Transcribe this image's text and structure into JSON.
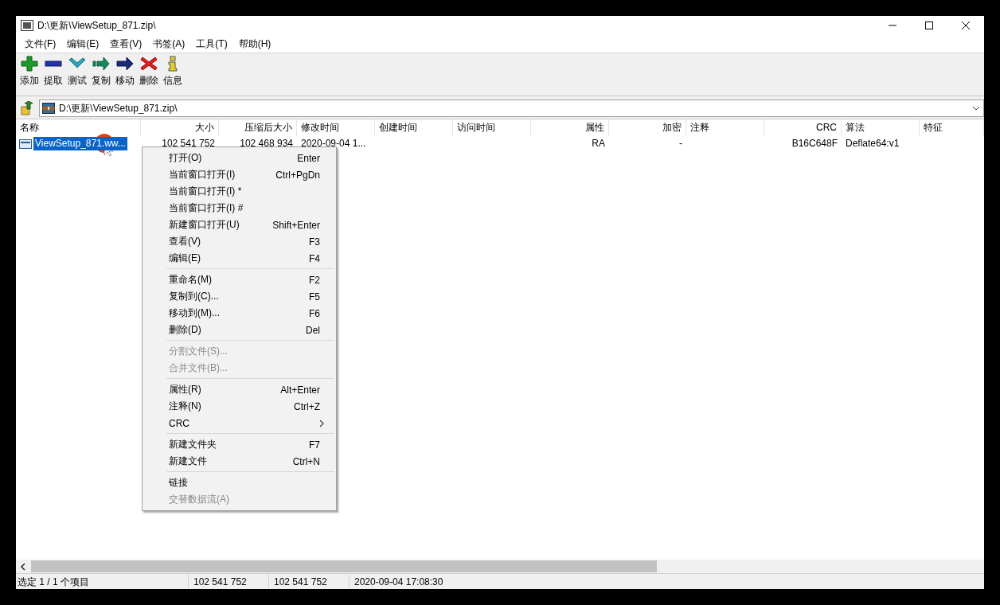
{
  "window": {
    "title": "D:\\更新\\ViewSetup_871.zip\\"
  },
  "menu_bar": [
    {
      "label": "文件(F)"
    },
    {
      "label": "编辑(E)"
    },
    {
      "label": "查看(V)"
    },
    {
      "label": "书签(A)"
    },
    {
      "label": "工具(T)"
    },
    {
      "label": "帮助(H)"
    }
  ],
  "toolbar": [
    {
      "kind": "add",
      "label": "添加"
    },
    {
      "kind": "extract",
      "label": "提取"
    },
    {
      "kind": "test",
      "label": "测试"
    },
    {
      "kind": "copy",
      "label": "复制"
    },
    {
      "kind": "move",
      "label": "移动"
    },
    {
      "kind": "delete",
      "label": "删除"
    },
    {
      "kind": "info",
      "label": "信息"
    }
  ],
  "address_bar": {
    "path": "D:\\更新\\ViewSetup_871.zip\\"
  },
  "file_list": {
    "columns": [
      {
        "label": "名称",
        "kind": "text"
      },
      {
        "label": "大小",
        "kind": "number"
      },
      {
        "label": "压缩后大小",
        "kind": "number"
      },
      {
        "label": "修改时间",
        "kind": "text"
      },
      {
        "label": "创建时间",
        "kind": "text"
      },
      {
        "label": "访问时间",
        "kind": "text"
      },
      {
        "label": "属性",
        "kind": "number"
      },
      {
        "label": "加密",
        "kind": "number"
      },
      {
        "label": "注释",
        "kind": "text"
      },
      {
        "label": "CRC",
        "kind": "number"
      },
      {
        "label": "算法",
        "kind": "text"
      },
      {
        "label": "特征",
        "kind": "text"
      }
    ],
    "rows": [
      {
        "selected": true,
        "cells": [
          "ViewSetup_871.ww...",
          "102 541 752",
          "102 468 934",
          "2020-09-04 1...",
          null,
          null,
          "RA",
          "-",
          null,
          "B16C648F",
          "Deflate64:v1",
          null
        ]
      }
    ]
  },
  "context_menu": {
    "items": [
      {
        "kind": "item",
        "label": "打开(O)",
        "shortcut": "Enter",
        "disabled": false
      },
      {
        "kind": "item",
        "label": "当前窗口打开(I)",
        "shortcut": "Ctrl+PgDn",
        "disabled": false
      },
      {
        "kind": "item",
        "label": "当前窗口打开(I) *",
        "disabled": false
      },
      {
        "kind": "item",
        "label": "当前窗口打开(I) #",
        "disabled": false
      },
      {
        "kind": "item",
        "label": "新建窗口打开(U)",
        "shortcut": "Shift+Enter",
        "disabled": false
      },
      {
        "kind": "item",
        "label": "查看(V)",
        "shortcut": "F3",
        "disabled": false
      },
      {
        "kind": "item",
        "label": "编辑(E)",
        "shortcut": "F4",
        "disabled": false
      },
      {
        "kind": "separator"
      },
      {
        "kind": "item",
        "label": "重命名(M)",
        "shortcut": "F2",
        "disabled": false
      },
      {
        "kind": "item",
        "label": "复制到(C)...",
        "shortcut": "F5",
        "disabled": false
      },
      {
        "kind": "item",
        "label": "移动到(M)...",
        "shortcut": "F6",
        "disabled": false
      },
      {
        "kind": "item",
        "label": "删除(D)",
        "shortcut": "Del",
        "disabled": false
      },
      {
        "kind": "separator"
      },
      {
        "kind": "item",
        "label": "分割文件(S)...",
        "disabled": true
      },
      {
        "kind": "item",
        "label": "合并文件(B)...",
        "disabled": true
      },
      {
        "kind": "separator"
      },
      {
        "kind": "item",
        "label": "属性(R)",
        "shortcut": "Alt+Enter",
        "disabled": false
      },
      {
        "kind": "item",
        "label": "注释(N)",
        "shortcut": "Ctrl+Z",
        "disabled": false
      },
      {
        "kind": "submenu",
        "label": "CRC",
        "disabled": false
      },
      {
        "kind": "separator"
      },
      {
        "kind": "item",
        "label": "新建文件夹",
        "shortcut": "F7",
        "disabled": false
      },
      {
        "kind": "item",
        "label": "新建文件",
        "shortcut": "Ctrl+N",
        "disabled": false
      },
      {
        "kind": "separator"
      },
      {
        "kind": "item",
        "label": "链接",
        "disabled": false
      },
      {
        "kind": "item",
        "label": "交替数据流(A)",
        "disabled": true
      }
    ]
  },
  "status_bar": [
    {
      "text": "选定 1 / 1 个项目"
    },
    {
      "text": "102 541 752"
    },
    {
      "text": "102 541 752"
    },
    {
      "text": "2020-09-04 17:08:30"
    }
  ]
}
